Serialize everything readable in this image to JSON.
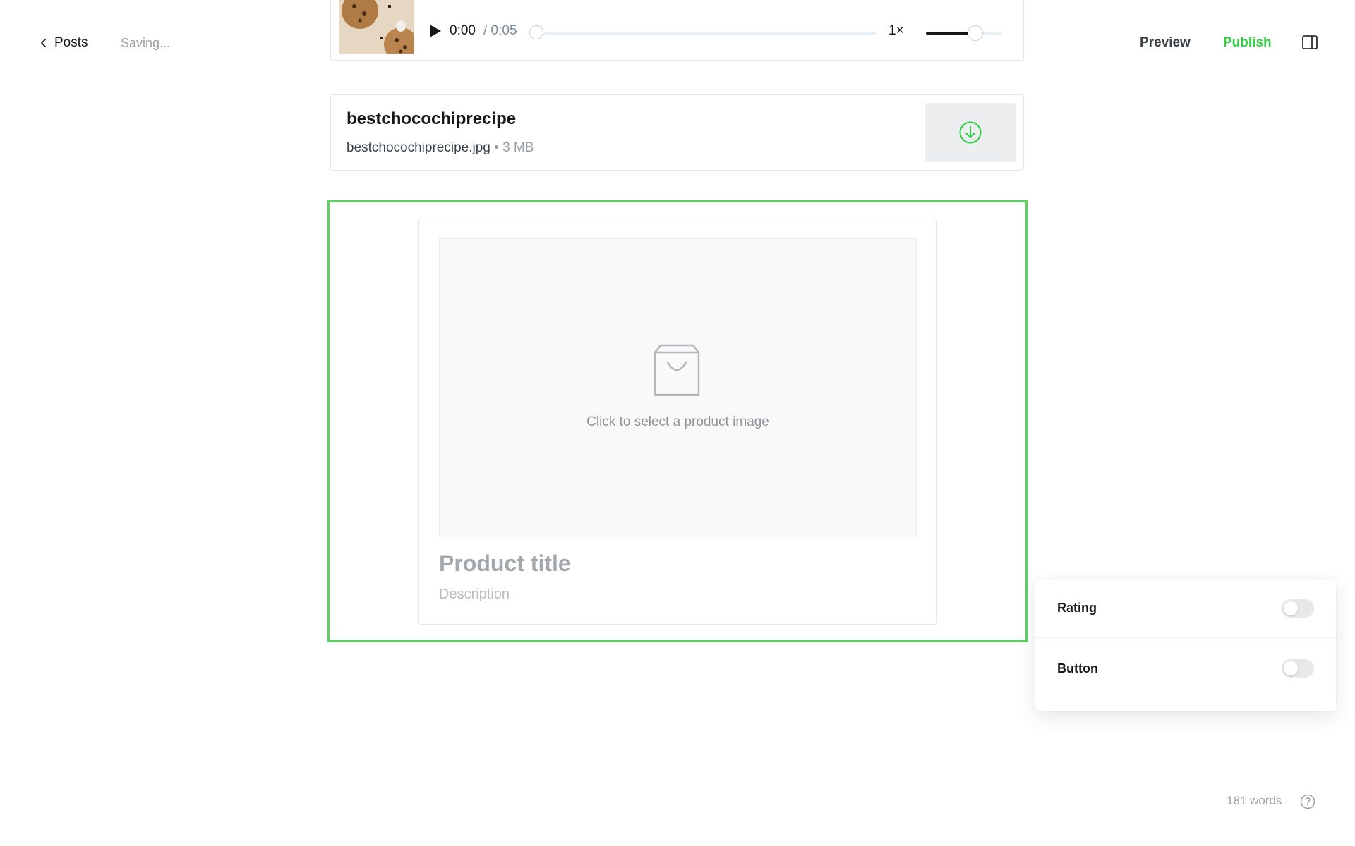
{
  "header": {
    "back_label": "Posts",
    "status_text": "Saving...",
    "preview_label": "Preview",
    "publish_label": "Publish",
    "publish_color": "#30cf43"
  },
  "audio_player": {
    "current_time": "0:00",
    "duration_text": "/ 0:05",
    "speed": "1×",
    "progress": 0.0,
    "volume": 0.65,
    "thumbnail": "cookies-thumbnail"
  },
  "file": {
    "title": "bestchocochiprecipe",
    "filename": "bestchocochiprecipe.jpg",
    "separator": "•",
    "size": "3 MB",
    "download_icon": "download-circle-icon"
  },
  "product": {
    "image_hint": "Click to select a product image",
    "title_placeholder": "Product title",
    "description_placeholder": "Description",
    "image_icon": "shopping-bag-icon"
  },
  "settings": {
    "rows": [
      {
        "label": "Rating",
        "enabled": false
      },
      {
        "label": "Button",
        "enabled": false
      }
    ]
  },
  "footer": {
    "word_count": "181 words",
    "help_icon": "help-circle-icon"
  },
  "colors": {
    "accent": "#30cf43",
    "selection_border": "#5ed066"
  }
}
